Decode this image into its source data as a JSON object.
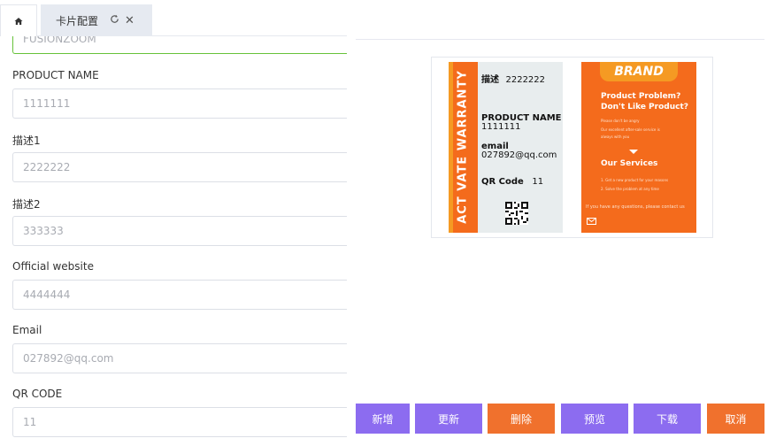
{
  "tabs": {
    "home_icon": "home-icon",
    "card_tab_label": "卡片配置",
    "refresh_icon": "refresh-icon",
    "close_icon": "close-icon"
  },
  "form": {
    "brand_value": "FUSIONZOOM",
    "fields": [
      {
        "label": "PRODUCT NAME",
        "value": "1111111"
      },
      {
        "label": "描述1",
        "value": "2222222"
      },
      {
        "label": "描述2",
        "value": "333333"
      },
      {
        "label": "Official website",
        "value": "4444444"
      },
      {
        "label": "Email",
        "value": "027892@qq.com"
      },
      {
        "label": "QR CODE",
        "value": "11"
      }
    ]
  },
  "preview": {
    "front": {
      "vertical_text": "ACT VATE   WARRANTY",
      "desc_label": "描述",
      "desc_value": "2222222",
      "product_label": "PRODUCT NAME",
      "product_value": "1111111",
      "email_label": "email",
      "email_value": "027892@qq.com",
      "qr_label": "QR Code",
      "qr_value": "11"
    },
    "back": {
      "brand": "BRAND",
      "title_line1": "Product Problem?",
      "title_line2": "Don't Like Product?",
      "small_1": "Please don't be angry",
      "small_2": "Our excellent after-sale service is",
      "small_3": "always with you",
      "services_title": "Our Services",
      "service_1": "1. Get a new product for your reasons",
      "service_2": "2. Solve the problem at any time",
      "contact": "If you have any questions, please contact us"
    }
  },
  "buttons": {
    "add": "新增",
    "update": "更新",
    "delete": "删除",
    "preview": "预览",
    "download": "下载",
    "cancel": "取消"
  },
  "colors": {
    "purple": "#8c6cf0",
    "orange": "#f0712d",
    "card_orange": "#f46b1c",
    "card_gray": "#e8edee"
  }
}
